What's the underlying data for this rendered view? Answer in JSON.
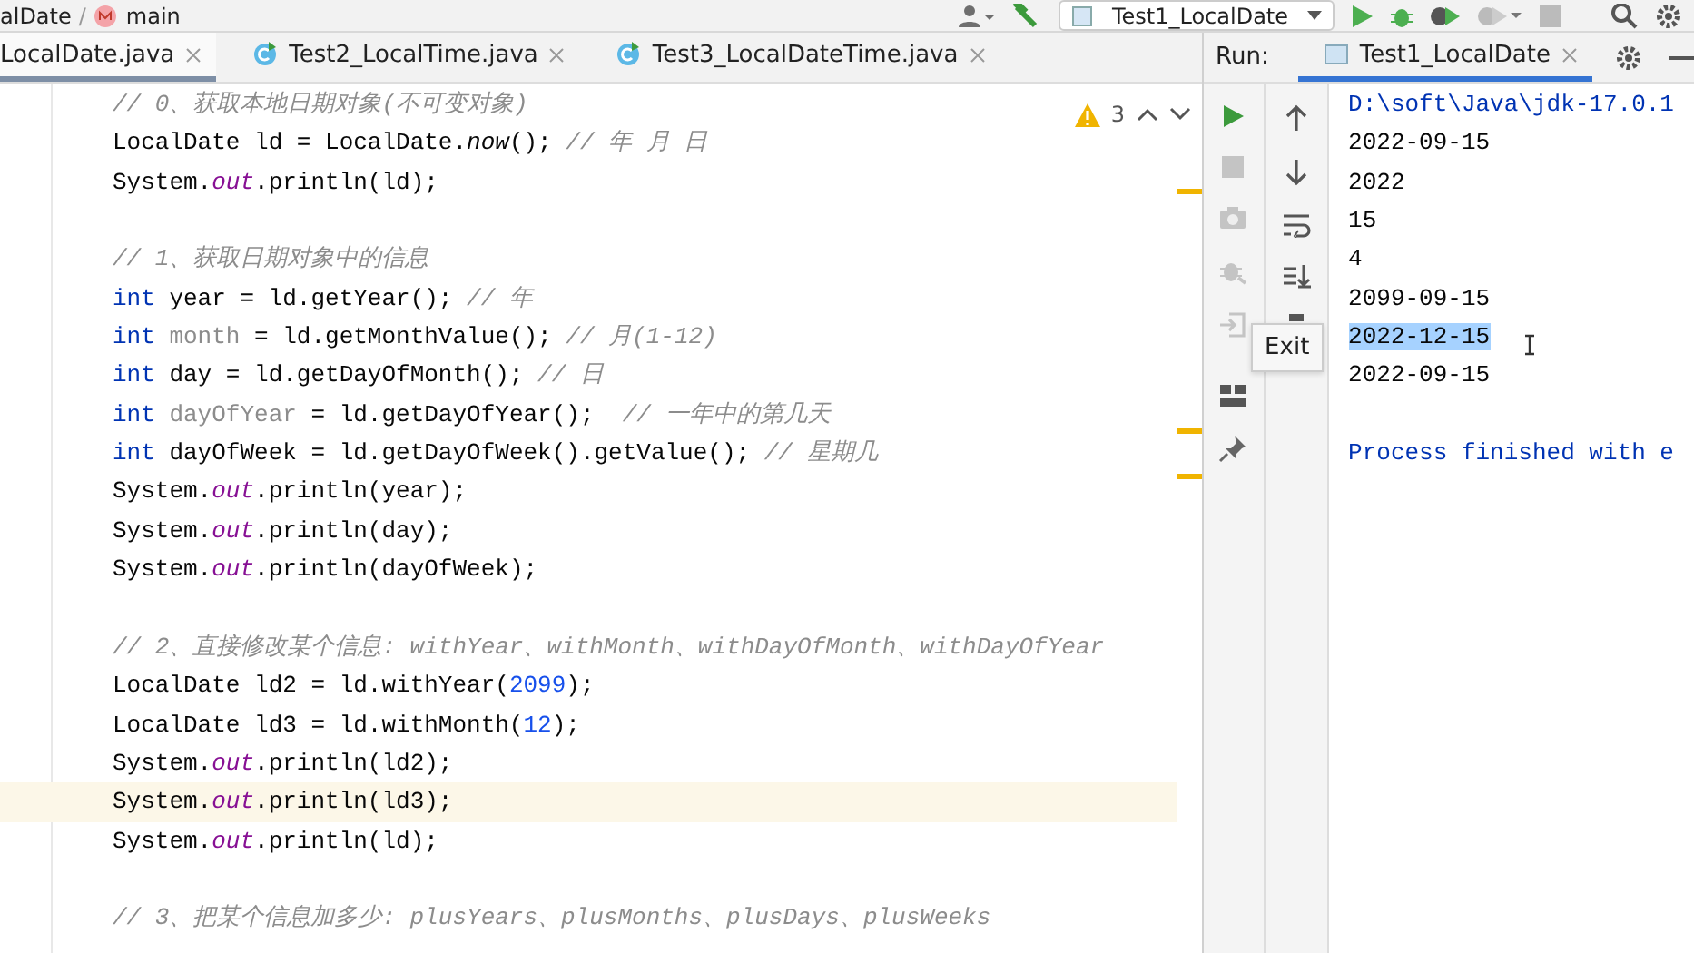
{
  "breadcrumb": [
    {
      "text": "alDate"
    },
    {
      "text": "main"
    }
  ],
  "breadcrumb_separator": "/",
  "run_config": "Test1_LocalDate",
  "editor_tabs": [
    {
      "label": "LocalDate.java",
      "selected": true
    },
    {
      "label": "Test2_LocalTime.java",
      "selected": false
    },
    {
      "label": "Test3_LocalDateTime.java",
      "selected": false
    }
  ],
  "editor": {
    "warning_count": "3",
    "lines": [
      {
        "current": false,
        "tokens": [
          {
            "kind": "comment",
            "text": "// 0、获取本地日期对象(不可变对象)"
          }
        ]
      },
      {
        "current": false,
        "tokens": [
          {
            "kind": "plain",
            "text": "LocalDate ld = LocalDate."
          },
          {
            "kind": "static",
            "text": "now"
          },
          {
            "kind": "plain",
            "text": "(); "
          },
          {
            "kind": "comment",
            "text": "// 年 月 日"
          }
        ]
      },
      {
        "current": false,
        "tokens": [
          {
            "kind": "plain",
            "text": "System."
          },
          {
            "kind": "field",
            "text": "out"
          },
          {
            "kind": "plain",
            "text": ".println(ld);"
          }
        ]
      },
      {
        "current": false
      },
      {
        "current": false,
        "tokens": [
          {
            "kind": "comment",
            "text": "// 1、获取日期对象中的信息"
          }
        ]
      },
      {
        "current": false,
        "tokens": [
          {
            "kind": "keyword",
            "text": "int"
          },
          {
            "kind": "plain",
            "text": " year = ld.getYear(); "
          },
          {
            "kind": "comment",
            "text": "// 年"
          }
        ]
      },
      {
        "current": false,
        "tokens": [
          {
            "kind": "keyword",
            "text": "int"
          },
          {
            "kind": "unused",
            "text": " month"
          },
          {
            "kind": "plain",
            "text": " = ld.getMonthValue(); "
          },
          {
            "kind": "comment",
            "text": "// 月(1-12)"
          }
        ]
      },
      {
        "current": false,
        "tokens": [
          {
            "kind": "keyword",
            "text": "int"
          },
          {
            "kind": "plain",
            "text": " day = ld.getDayOfMonth(); "
          },
          {
            "kind": "comment",
            "text": "// 日"
          }
        ]
      },
      {
        "current": false,
        "tokens": [
          {
            "kind": "keyword",
            "text": "int"
          },
          {
            "kind": "unused",
            "text": " dayOfYear"
          },
          {
            "kind": "plain",
            "text": " = ld.getDayOfYear();  "
          },
          {
            "kind": "comment",
            "text": "// 一年中的第几天"
          }
        ]
      },
      {
        "current": false,
        "tokens": [
          {
            "kind": "keyword",
            "text": "int"
          },
          {
            "kind": "plain",
            "text": " dayOfWeek = ld.getDayOfWeek().getValue(); "
          },
          {
            "kind": "comment",
            "text": "// 星期几"
          }
        ]
      },
      {
        "current": false,
        "tokens": [
          {
            "kind": "plain",
            "text": "System."
          },
          {
            "kind": "field",
            "text": "out"
          },
          {
            "kind": "plain",
            "text": ".println(year);"
          }
        ]
      },
      {
        "current": false,
        "tokens": [
          {
            "kind": "plain",
            "text": "System."
          },
          {
            "kind": "field",
            "text": "out"
          },
          {
            "kind": "plain",
            "text": ".println(day);"
          }
        ]
      },
      {
        "current": false,
        "tokens": [
          {
            "kind": "plain",
            "text": "System."
          },
          {
            "kind": "field",
            "text": "out"
          },
          {
            "kind": "plain",
            "text": ".println(dayOfWeek);"
          }
        ]
      },
      {
        "current": false
      },
      {
        "current": false,
        "tokens": [
          {
            "kind": "comment",
            "text": "// 2、直接修改某个信息: withYear、withMonth、withDayOfMonth、withDayOfYear"
          }
        ]
      },
      {
        "current": false,
        "tokens": [
          {
            "kind": "plain",
            "text": "LocalDate ld2 = ld.withYear("
          },
          {
            "kind": "number",
            "text": "2099"
          },
          {
            "kind": "plain",
            "text": ");"
          }
        ]
      },
      {
        "current": false,
        "tokens": [
          {
            "kind": "plain",
            "text": "LocalDate ld3 = ld.withMonth("
          },
          {
            "kind": "number",
            "text": "12"
          },
          {
            "kind": "plain",
            "text": ");"
          }
        ]
      },
      {
        "current": false,
        "tokens": [
          {
            "kind": "plain",
            "text": "System."
          },
          {
            "kind": "field",
            "text": "out"
          },
          {
            "kind": "plain",
            "text": ".println(ld2);"
          }
        ]
      },
      {
        "current": true,
        "tokens": [
          {
            "kind": "plain",
            "text": "System."
          },
          {
            "kind": "field",
            "text": "out"
          },
          {
            "kind": "plain",
            "text": ".println(ld3);"
          }
        ]
      },
      {
        "current": false,
        "tokens": [
          {
            "kind": "plain",
            "text": "System."
          },
          {
            "kind": "field",
            "text": "out"
          },
          {
            "kind": "plain",
            "text": ".println(ld);"
          }
        ]
      },
      {
        "current": false
      },
      {
        "current": false,
        "tokens": [
          {
            "kind": "comment",
            "text": "// 3、把某个信息加多少: plusYears、plusMonths、plusDays、plusWeeks"
          }
        ]
      }
    ]
  },
  "run_panel": {
    "label": "Run:",
    "tab": "Test1_LocalDate",
    "tooltip": "Exit",
    "output": [
      {
        "kind": "path",
        "text": "D:\\soft\\Java\\jdk-17.0.1",
        "selected": false
      },
      {
        "kind": "plain",
        "text": "2022-09-15",
        "selected": false
      },
      {
        "kind": "plain",
        "text": "2022",
        "selected": false
      },
      {
        "kind": "plain",
        "text": "15",
        "selected": false
      },
      {
        "kind": "plain",
        "text": "4",
        "selected": false
      },
      {
        "kind": "plain",
        "text": "2099-09-15",
        "selected": false
      },
      {
        "kind": "plain",
        "text": "2022-12-15",
        "selected": true
      },
      {
        "kind": "plain",
        "text": "2022-09-15",
        "selected": false
      },
      {
        "kind": "status",
        "text": "Process finished with e",
        "selected": false
      }
    ]
  }
}
